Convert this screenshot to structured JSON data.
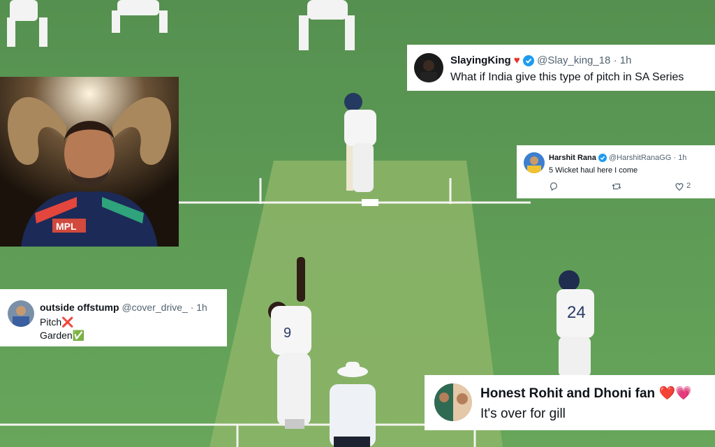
{
  "tweets": [
    {
      "name": "SlayingKing",
      "name_emoji": "fire-heart-icon",
      "handle": "@Slay_king_18",
      "time": "· 1h",
      "text": "What if India give this type of pitch in SA Series"
    },
    {
      "name": "Harshit Rana",
      "handle": "@HarshitRanaGG",
      "time": "· 1h",
      "text": "5 Wicket haul here I come",
      "likes": "2"
    },
    {
      "name": "outside offstump",
      "handle": "@cover_drive_",
      "time": "· 1h",
      "line1": "Pitch",
      "line1_emoji": "❌",
      "line2": "Garden",
      "line2_emoji": "✅"
    },
    {
      "name": "Honest Rohit and Dhoni fan",
      "name_emoji": "❤️💗",
      "text": "It's over for gill"
    }
  ],
  "scene": {
    "bowler_number": "9",
    "batter_number": "24",
    "jersey_logo": "MPL",
    "colors": {
      "grass": "#5d9b55",
      "pitch": "#8fb56a",
      "verified": "#1d9bf0"
    }
  }
}
